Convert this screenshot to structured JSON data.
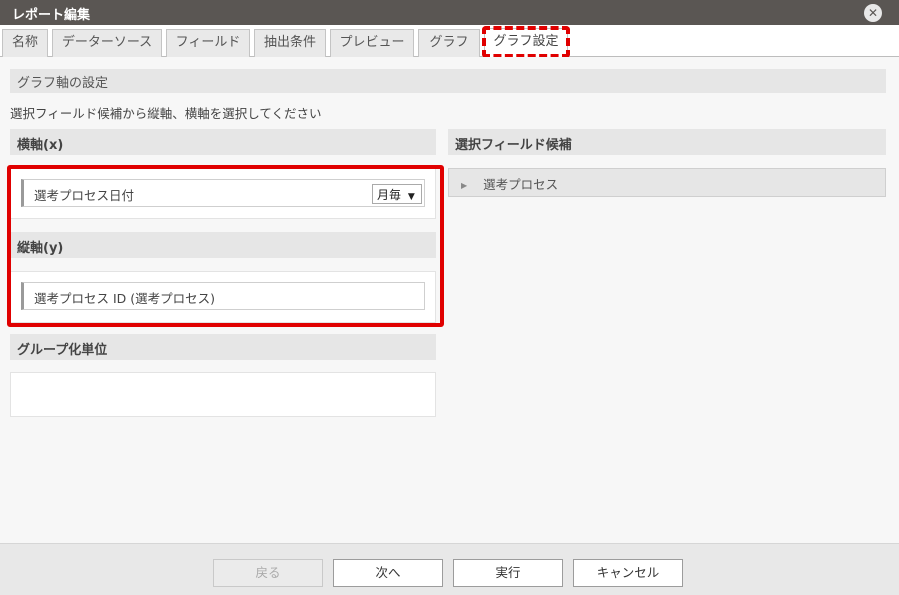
{
  "window": {
    "title": "レポート編集",
    "close_label": "✕"
  },
  "tabs": [
    {
      "label": "名称"
    },
    {
      "label": "データーソース"
    },
    {
      "label": "フィールド"
    },
    {
      "label": "抽出条件"
    },
    {
      "label": "プレビュー"
    },
    {
      "label": "グラフ"
    },
    {
      "label": "グラフ設定",
      "active": true
    }
  ],
  "section": {
    "title": "グラフ軸の設定",
    "description": "選択フィールド候補から縦軸、横軸を選択してください"
  },
  "x_axis": {
    "label": "横軸(x)",
    "field": "選考プロセス日付",
    "interval": {
      "selected": "月毎"
    }
  },
  "y_axis": {
    "label": "縦軸(y)",
    "field": "選考プロセス ID (選考プロセス)"
  },
  "grouping": {
    "label": "グループ化単位"
  },
  "candidates": {
    "label": "選択フィールド候補",
    "items": [
      {
        "label": "選考プロセス"
      }
    ]
  },
  "footer": {
    "back_label": "戻る",
    "next_label": "次へ",
    "run_label": "実行",
    "cancel_label": "キャンセル"
  },
  "colors": {
    "highlight": "#e00000",
    "titlebar": "#5a5653"
  }
}
